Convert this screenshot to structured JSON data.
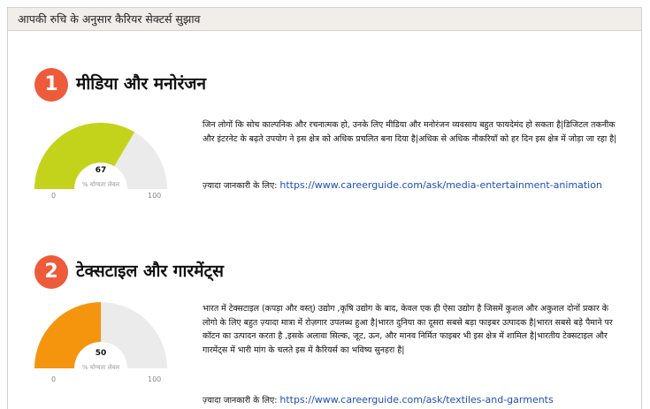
{
  "header": {
    "title": "आपकी रुचि के अनुसार कैरियर सेक्टर्स सुझाव"
  },
  "careers": [
    {
      "rank": "1",
      "title": "मीडिया और मनोरंजन",
      "gauge": {
        "value": 67,
        "value_label": "67",
        "caption": "% योग्यता लेवल",
        "min": "0",
        "max": "100",
        "color": "#c3d31c"
      },
      "description": "जिन लोगों कि सोच काल्पनिक और रचनात्मक हो, उनके लिए मीडिया और मनोरंजन व्यवसाय बहुत फायदेमंद हो सकता है|डिजिटल तकनीक और इंटरनेट के बढ़ते उपयोग ने इस क्षेत्र को अधिक प्रचलित बना दिया है|अधिक से अधिक नौकरियाँ को हर दिन इस क्षेत्र में जोड़ा जा रहा है|",
      "more_label": "ज़्यादा जानकारी के लिए:",
      "link": "https://www.careerguide.com/ask/media-entertainment-animation"
    },
    {
      "rank": "2",
      "title": "टेक्सटाइल और गारमेंट्स",
      "gauge": {
        "value": 50,
        "value_label": "50",
        "caption": "% योग्यता लेवल",
        "min": "0",
        "max": "100",
        "color": "#f5950e"
      },
      "description": "भारत में टेक्सटाइल (कपड़ा और वस्त्) उद्योग ,कृषि उद्योग के बाद, केवल एक ही ऐसा उद्योग है जिसमें कुशल और अकुशल दोनों प्रकार के लोगो के लिए बहुत ज़्यादा मात्रा में रोज़गार उपलब्ध हुआ है|भारत दुनिया का दूसरा सबसे बड़ा फाइबर उत्पादक है|भारत सबसे बड़े पैमाने पर कॉटन का उत्पादन करता है ,इसके अलावा सिल्क, जूट, ऊन, और मानव निर्मित फाइबर भी इस क्षेत्र में शामिल है|भारतीय टेक्सटाइल और गारमेंट्स में भारी मांग के चलते इस में कैरियर्स का भविष्य सुनहरा है|",
      "more_label": "ज़्यादा जानकारी के लिए:",
      "link": "https://www.careerguide.com/ask/textiles-and-garments"
    }
  ]
}
